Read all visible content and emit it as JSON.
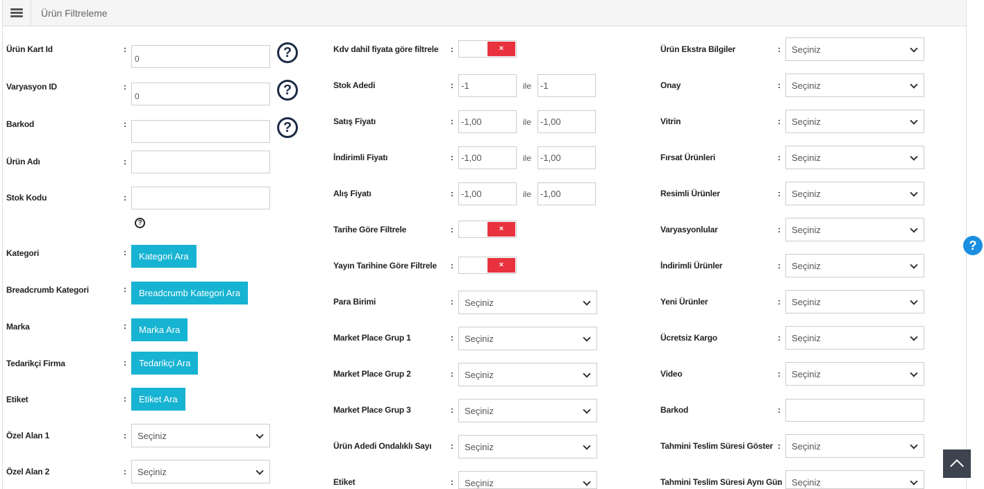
{
  "header": {
    "title": "Ürün Filtreleme"
  },
  "common": {
    "colon": ":",
    "ile": "ile",
    "select_placeholder": "Seçiniz",
    "toggle_off": "×",
    "help": "?"
  },
  "col1": {
    "product_card_id": {
      "label": "Ürün Kart Id",
      "value": "0"
    },
    "variation_id": {
      "label": "Varyasyon ID",
      "value": "0"
    },
    "barcode": {
      "label": "Barkod",
      "value": ""
    },
    "product_name": {
      "label": "Ürün Adı",
      "value": ""
    },
    "stock_code": {
      "label": "Stok Kodu",
      "value": ""
    },
    "category": {
      "label": "Kategori",
      "button": "Kategori Ara"
    },
    "breadcrumb_category": {
      "label": "Breadcrumb Kategori",
      "button": "Breadcrumb Kategori Ara"
    },
    "brand": {
      "label": "Marka",
      "button": "Marka Ara"
    },
    "supplier": {
      "label": "Tedarikçi Firma",
      "button": "Tedarikçi Ara"
    },
    "tag": {
      "label": "Etiket",
      "button": "Etiket Ara"
    },
    "custom_field_1": {
      "label": "Özel Alan 1",
      "value": "Seçiniz"
    },
    "custom_field_2": {
      "label": "Özel Alan 2",
      "value": "Seçiniz"
    }
  },
  "col2": {
    "vat_filter": {
      "label": "Kdv dahil fiyata göre filtrele",
      "enabled": false
    },
    "stock_count": {
      "label": "Stok Adedi",
      "from": "-1",
      "to": "-1"
    },
    "sale_price": {
      "label": "Satış Fiyatı",
      "from": "-1,00",
      "to": "-1,00"
    },
    "discounted_price": {
      "label": "İndirimli Fiyatı",
      "from": "-1,00",
      "to": "-1,00"
    },
    "purchase_price": {
      "label": "Alış Fiyatı",
      "from": "-1,00",
      "to": "-1,00"
    },
    "date_filter": {
      "label": "Tarihe Göre Filtrele",
      "enabled": false
    },
    "publish_date_filter": {
      "label": "Yayın Tarihine Göre Filtrele",
      "enabled": false
    },
    "currency": {
      "label": "Para Birimi",
      "value": "Seçiniz"
    },
    "mp_group_1": {
      "label": "Market Place Grup 1",
      "value": "Seçiniz"
    },
    "mp_group_2": {
      "label": "Market Place Grup 2",
      "value": "Seçiniz"
    },
    "mp_group_3": {
      "label": "Market Place Grup 3",
      "value": "Seçiniz"
    },
    "decimal_quantity": {
      "label": "Ürün Adedi Ondalıklı Sayı",
      "value": "Seçiniz"
    },
    "tag": {
      "label": "Etiket",
      "value": "Seçiniz"
    }
  },
  "col3": {
    "extra_info": {
      "label": "Ürün Ekstra Bilgiler",
      "value": "Seçiniz"
    },
    "approval": {
      "label": "Onay",
      "value": "Seçiniz"
    },
    "showcase": {
      "label": "Vitrin",
      "value": "Seçiniz"
    },
    "opportunity": {
      "label": "Fırsat Ürünleri",
      "value": "Seçiniz"
    },
    "with_images": {
      "label": "Resimli Ürünler",
      "value": "Seçiniz"
    },
    "variations": {
      "label": "Varyasyonlular",
      "value": "Seçiniz"
    },
    "discounted": {
      "label": "İndirimli Ürünler",
      "value": "Seçiniz"
    },
    "new_products": {
      "label": "Yeni Ürünler",
      "value": "Seçiniz"
    },
    "free_shipping": {
      "label": "Ücretsiz Kargo",
      "value": "Seçiniz"
    },
    "video": {
      "label": "Video",
      "value": "Seçiniz"
    },
    "barcode": {
      "label": "Barkod",
      "value": ""
    },
    "show_delivery_time": {
      "label": "Tahmini Teslim Süresi Göster",
      "value": "Seçiniz"
    },
    "delivery_same_day": {
      "label": "Tahmini Teslim Süresi Aynı Gün",
      "value": "Seçiniz"
    }
  }
}
